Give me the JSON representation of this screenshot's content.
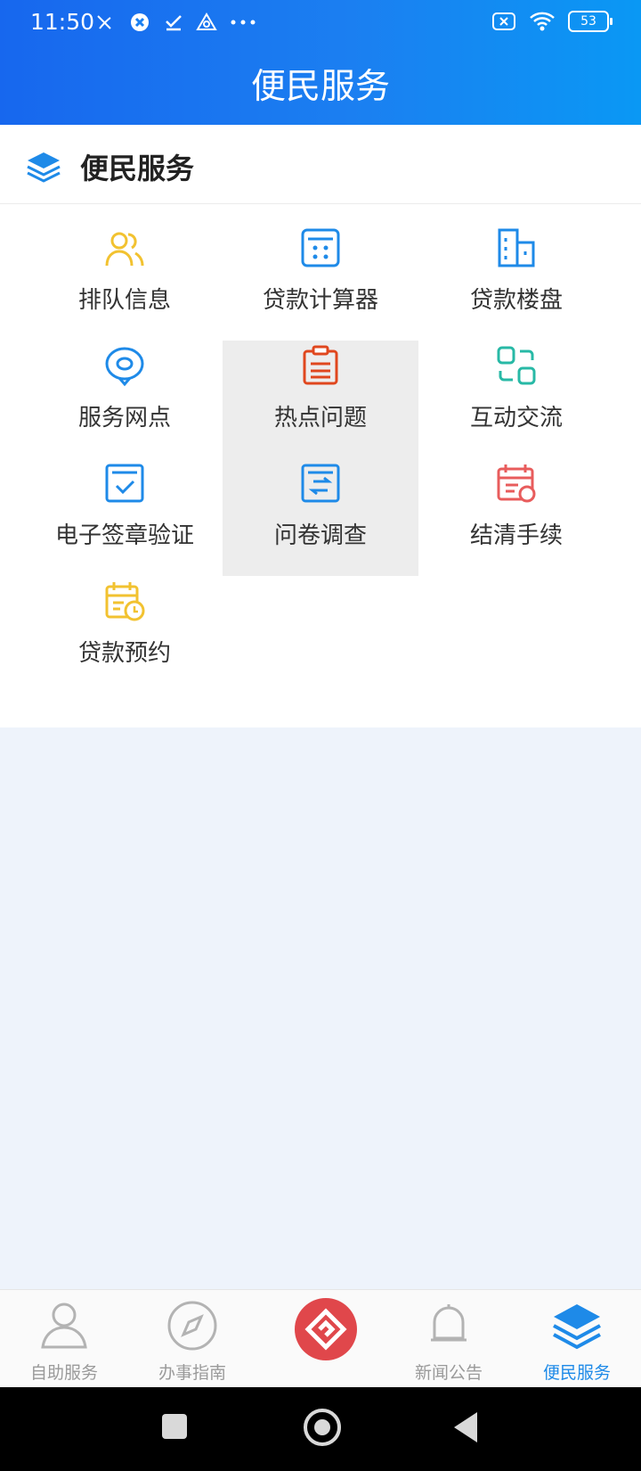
{
  "status": {
    "time": "11:50",
    "battery": "53"
  },
  "header": {
    "title": "便民服务"
  },
  "section": {
    "title": "便民服务"
  },
  "grid": {
    "items": [
      {
        "label": "排队信息"
      },
      {
        "label": "贷款计算器"
      },
      {
        "label": "贷款楼盘"
      },
      {
        "label": "服务网点"
      },
      {
        "label": "热点问题"
      },
      {
        "label": "互动交流"
      },
      {
        "label": "电子签章验证"
      },
      {
        "label": "问卷调查"
      },
      {
        "label": "结清手续"
      },
      {
        "label": "贷款预约"
      }
    ]
  },
  "tabs": {
    "items": [
      {
        "label": "自助服务"
      },
      {
        "label": "办事指南"
      },
      {
        "label": "新闻公告"
      },
      {
        "label": "便民服务"
      }
    ],
    "active_color": "#1e8ae8",
    "inactive_color": "#9a9a9a"
  },
  "colors": {
    "primary": "#1b7ff1",
    "accent_red": "#e0474b",
    "background": "#eef3fb"
  }
}
